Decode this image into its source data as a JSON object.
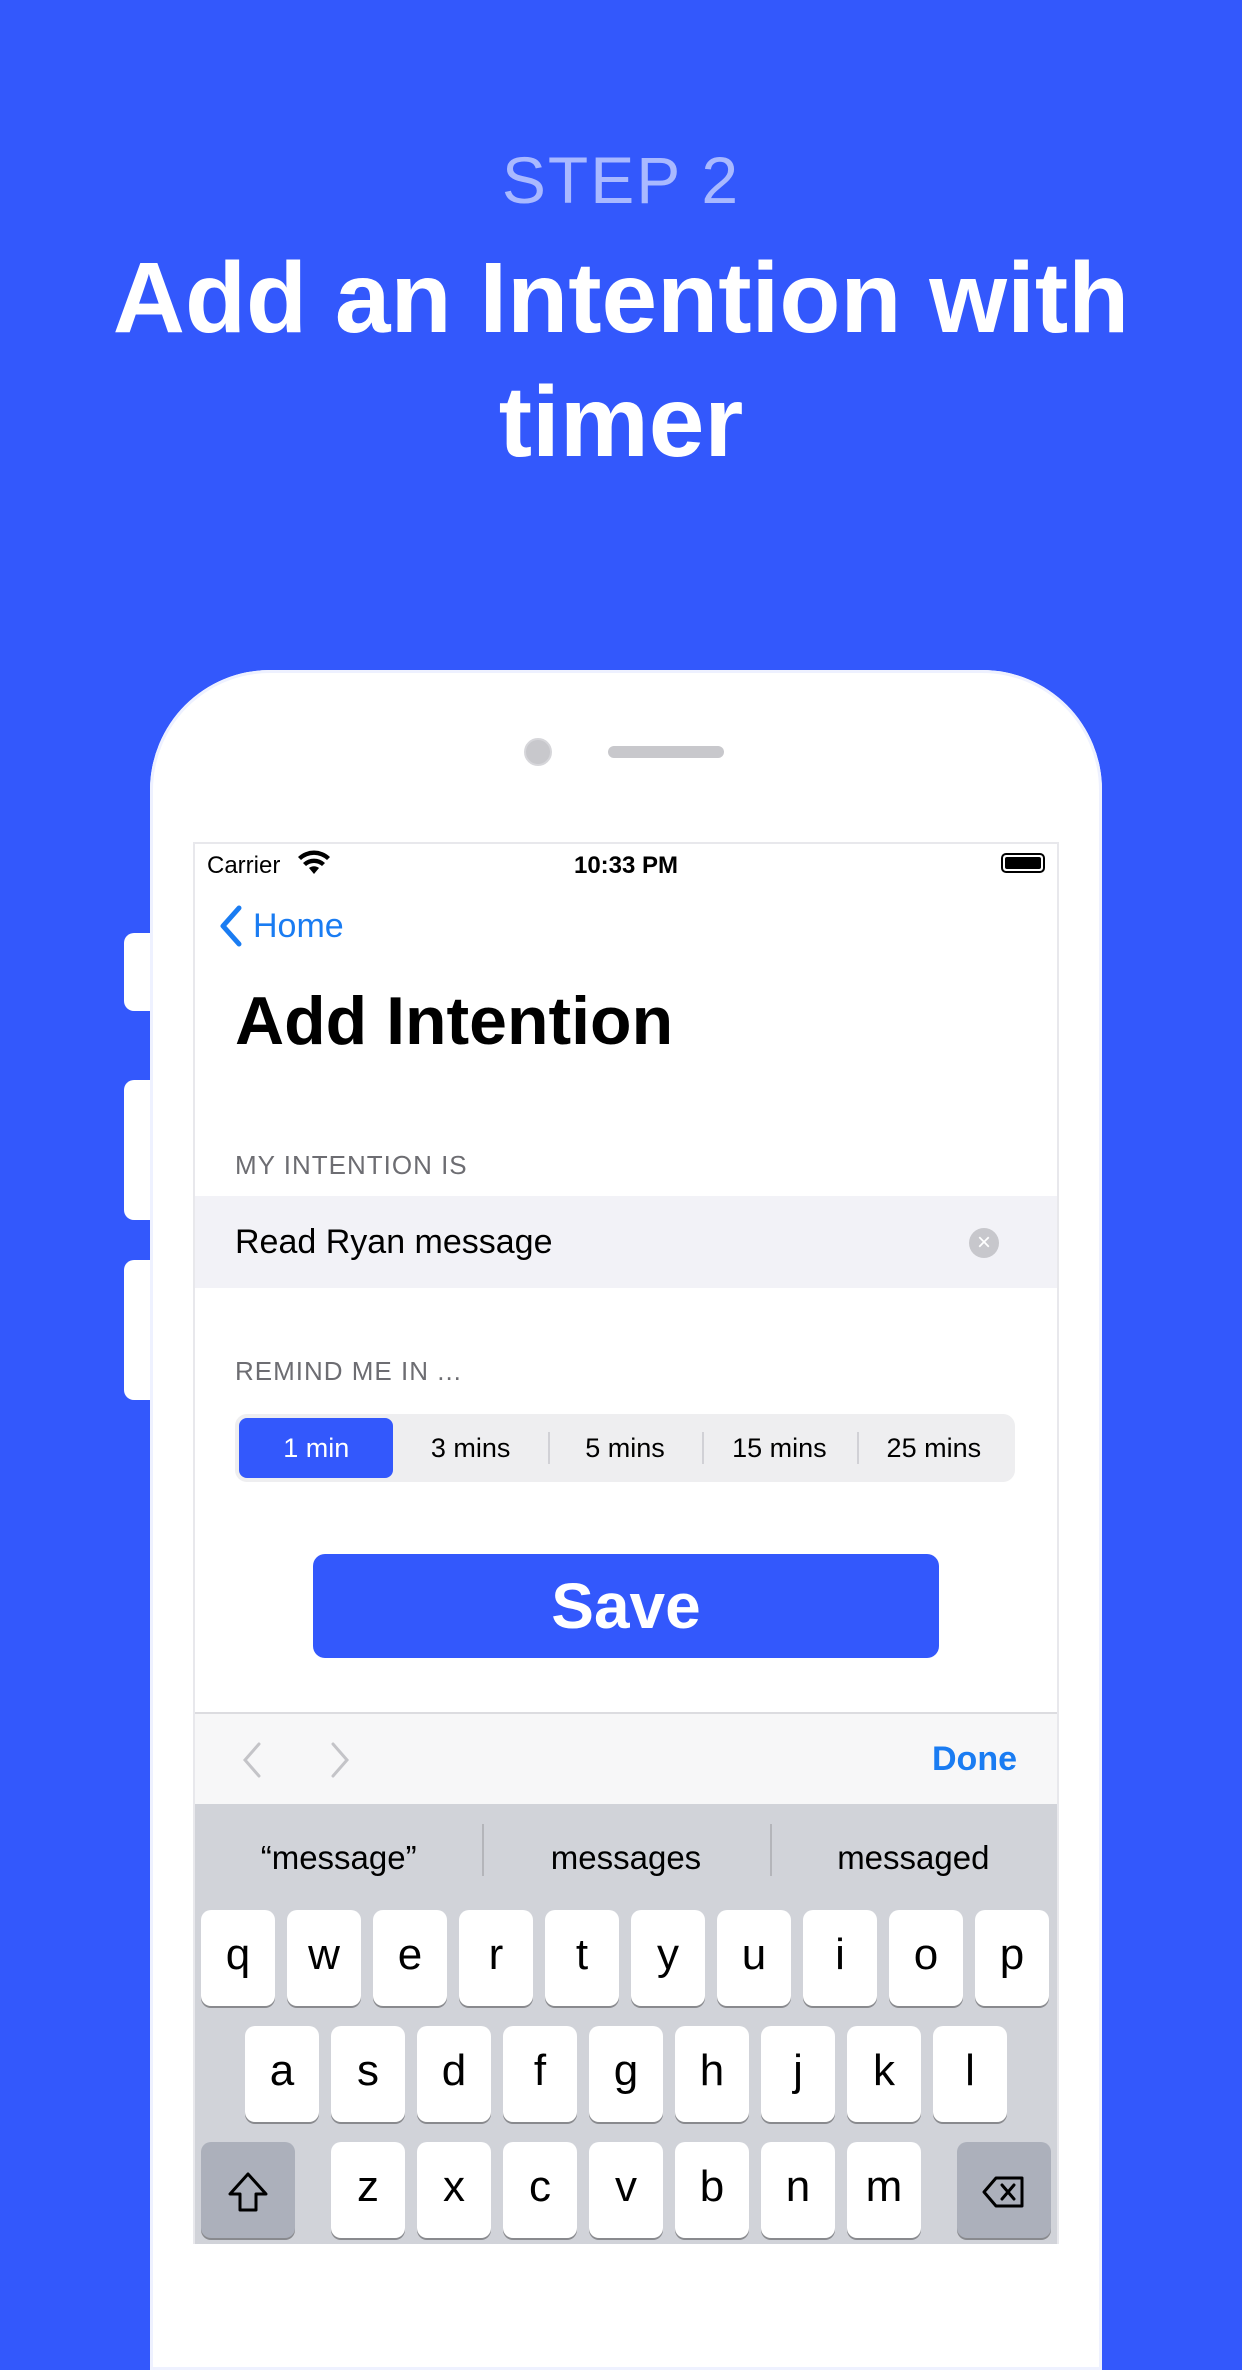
{
  "promo": {
    "step": "STEP 2",
    "title": "Add an Intention with timer"
  },
  "status_bar": {
    "carrier": "Carrier",
    "time": "10:33 PM"
  },
  "nav": {
    "back_label": "Home"
  },
  "page": {
    "title": "Add Intention",
    "intention_label": "MY INTENTION IS",
    "intention_value": "Read Ryan message",
    "remind_label": "REMIND ME IN ...",
    "durations": [
      "1 min",
      "3 mins",
      "5 mins",
      "15 mins",
      "25 mins"
    ],
    "selected_duration": "1 min",
    "save_label": "Save"
  },
  "accessory_bar": {
    "done_label": "Done"
  },
  "keyboard": {
    "suggestions": [
      "“message”",
      "messages",
      "messaged"
    ],
    "rows": [
      [
        "q",
        "w",
        "e",
        "r",
        "t",
        "y",
        "u",
        "i",
        "o",
        "p"
      ],
      [
        "a",
        "s",
        "d",
        "f",
        "g",
        "h",
        "j",
        "k",
        "l"
      ],
      [
        "z",
        "x",
        "c",
        "v",
        "b",
        "n",
        "m"
      ]
    ]
  },
  "colors": {
    "background": "#3358fc",
    "accent": "#3358fc",
    "link": "#1a7cf2"
  }
}
